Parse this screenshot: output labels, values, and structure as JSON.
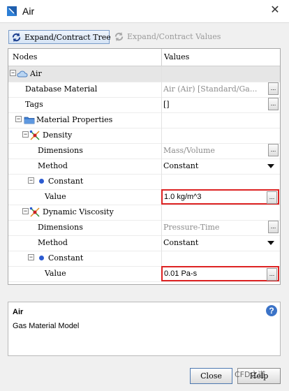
{
  "window": {
    "title": "Air"
  },
  "toolbar": {
    "expand_tree": "Expand/Contract Tree",
    "expand_values": "Expand/Contract Values"
  },
  "tree": {
    "header_nodes": "Nodes",
    "header_values": "Values",
    "rows": [
      {
        "label": "Air",
        "value": ""
      },
      {
        "label": "Database Material",
        "value": "Air (Air) [Standard/Ga..."
      },
      {
        "label": "Tags",
        "value": "[]"
      },
      {
        "label": "Material Properties",
        "value": ""
      },
      {
        "label": "Density",
        "value": ""
      },
      {
        "label": "Dimensions",
        "value": "Mass/Volume"
      },
      {
        "label": "Method",
        "value": "Constant"
      },
      {
        "label": "Constant",
        "value": ""
      },
      {
        "label": "Value",
        "value": "1.0 kg/m^3"
      },
      {
        "label": "Dynamic Viscosity",
        "value": ""
      },
      {
        "label": "Dimensions",
        "value": "Pressure-Time"
      },
      {
        "label": "Method",
        "value": "Constant"
      },
      {
        "label": "Constant",
        "value": ""
      },
      {
        "label": "Value",
        "value": "0.01 Pa-s"
      }
    ],
    "ellipsis": "..."
  },
  "description": {
    "title": "Air",
    "text": "Gas Material Model"
  },
  "buttons": {
    "close": "Close",
    "help": "Help"
  },
  "watermark": "CFD之道",
  "colors": {
    "highlight_border": "#dd2222",
    "selection": "#e6e6e6"
  }
}
